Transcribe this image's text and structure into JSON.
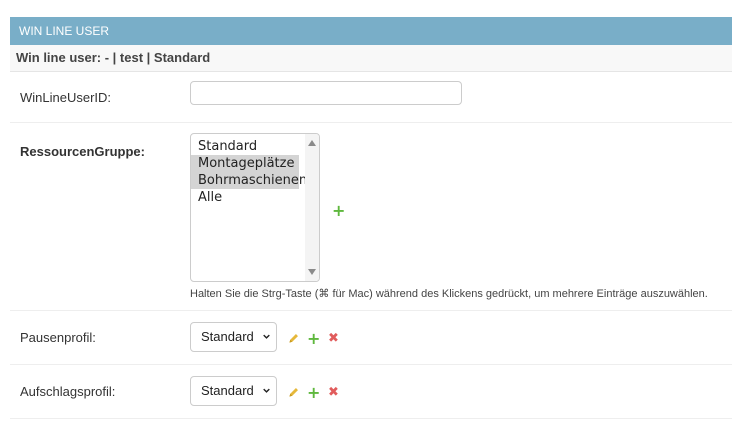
{
  "module": {
    "title": "WIN LINE USER",
    "inline_label": "Win line user: - | test | Standard"
  },
  "fields": {
    "winlineuserid": {
      "label": "WinLineUserID:",
      "value": ""
    },
    "ressourcengruppe": {
      "label": "RessourcenGruppe:",
      "options": [
        {
          "text": "Standard",
          "selected": false
        },
        {
          "text": "Montageplätze",
          "selected": true
        },
        {
          "text": "Bohrmaschienen",
          "selected": true
        },
        {
          "text": "Alle",
          "selected": false
        }
      ],
      "help": "Halten Sie die Strg-Taste (⌘ für Mac) während des Klickens gedrückt, um mehrere Einträge auszuwählen."
    },
    "pausenprofil": {
      "label": "Pausenprofil:",
      "selected": "Standard"
    },
    "aufschlagsprofil": {
      "label": "Aufschlagsprofil:",
      "selected": "Standard"
    }
  },
  "icons": {
    "add": "plus-icon",
    "change": "pencil-icon",
    "delete": "x-icon"
  },
  "colors": {
    "header_bg": "#79aec8",
    "add": "#5fb83e",
    "change": "#e6b83a",
    "delete": "#e15c5c"
  }
}
